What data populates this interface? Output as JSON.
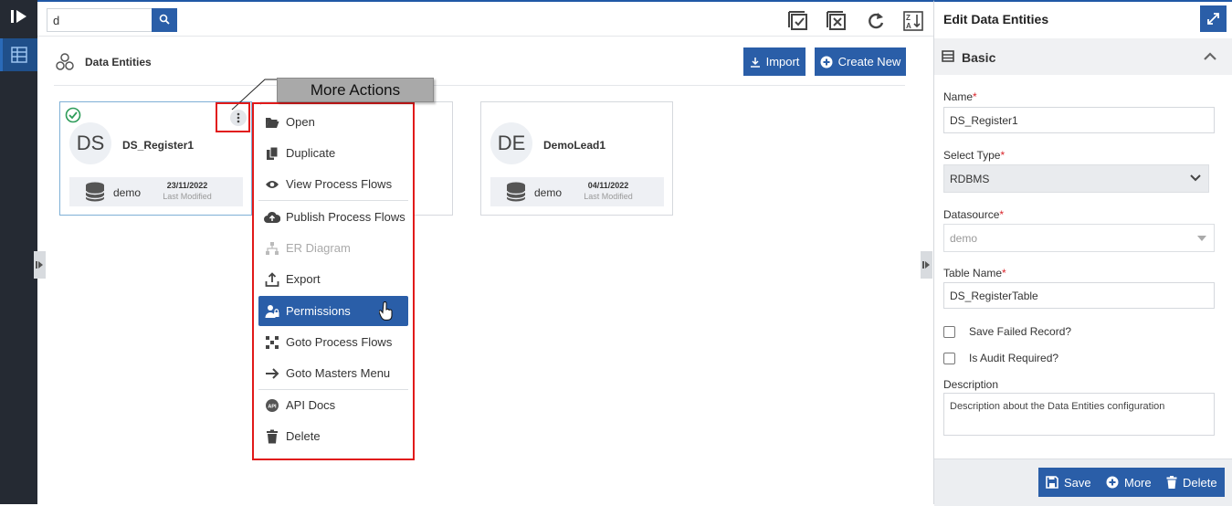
{
  "search": {
    "value": "d"
  },
  "header": {
    "title": "Data Entities",
    "import_label": "Import",
    "create_label": "Create New"
  },
  "cards": [
    {
      "initials": "DS",
      "name": "DS_Register1",
      "datasource": "demo",
      "date": "23/11/2022",
      "date_label": "Last Modified"
    },
    {
      "initials": "DE",
      "name": "DemoLead1",
      "datasource": "demo",
      "date": "04/11/2022",
      "date_label": "Last Modified"
    }
  ],
  "callout": "More Actions",
  "menu": [
    {
      "label": "Open",
      "icon": "folder-open-icon"
    },
    {
      "label": "Duplicate",
      "icon": "copy-icon"
    },
    {
      "label": "View Process Flows",
      "icon": "eye-icon"
    },
    {
      "label": "Publish Process Flows",
      "icon": "cloud-upload-icon"
    },
    {
      "label": "ER Diagram",
      "icon": "sitemap-icon",
      "disabled": true
    },
    {
      "label": "Export",
      "icon": "export-icon"
    },
    {
      "label": "Permissions",
      "icon": "user-lock-icon",
      "active": true
    },
    {
      "label": "Goto Process Flows",
      "icon": "process-flows-icon"
    },
    {
      "label": "Goto Masters Menu",
      "icon": "arrow-right-icon"
    },
    {
      "label": "API Docs",
      "icon": "api-icon"
    },
    {
      "label": "Delete",
      "icon": "trash-icon"
    }
  ],
  "panel": {
    "title": "Edit Data Entities",
    "section": "Basic",
    "name_label": "Name",
    "name_value": "DS_Register1",
    "type_label": "Select Type",
    "type_value": "RDBMS",
    "datasource_label": "Datasource",
    "datasource_value": "demo",
    "table_label": "Table Name",
    "table_value": "DS_RegisterTable",
    "save_failed_label": "Save Failed Record?",
    "audit_label": "Is Audit Required?",
    "description_label": "Description",
    "description_placeholder": "Description about the Data Entities configuration",
    "save_label": "Save",
    "more_label": "More",
    "delete_label": "Delete",
    "required_mark": "*"
  },
  "colors": {
    "primary": "#2a5ea8",
    "sidebar": "#252a33",
    "annotation": "#e11a1a",
    "success": "#2e9c5a"
  }
}
